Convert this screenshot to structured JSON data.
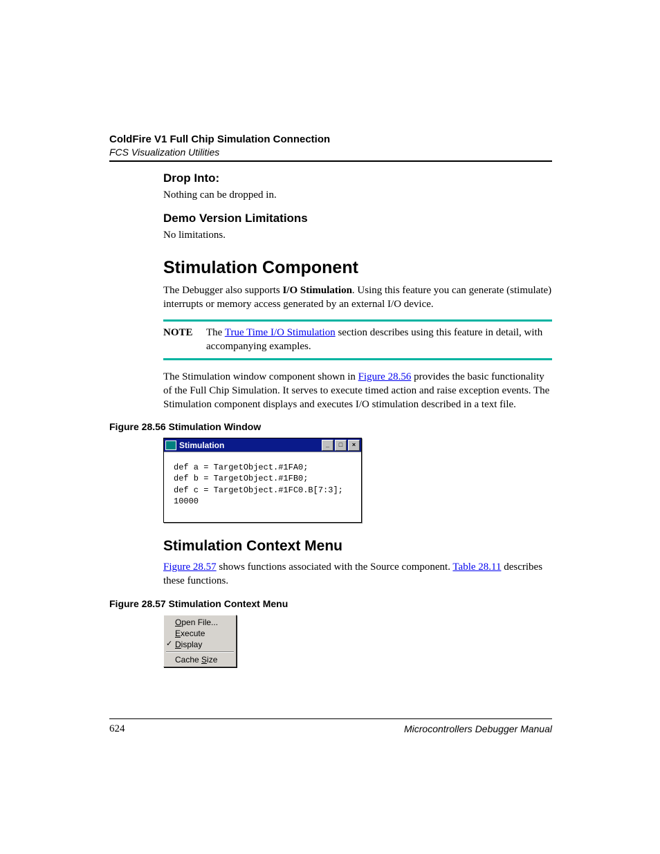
{
  "header": {
    "title": "ColdFire V1 Full Chip Simulation Connection",
    "subtitle": "FCS Visualization Utilities"
  },
  "sections": {
    "drop_into": {
      "heading": "Drop Into:",
      "body": "Nothing can be dropped in."
    },
    "demo_limits": {
      "heading": "Demo Version Limitations",
      "body": "No limitations."
    },
    "stim_comp": {
      "heading": "Stimulation Component",
      "p1_a": "The Debugger also supports ",
      "p1_bold": "I/O Stimulation",
      "p1_b": ". Using this feature you can generate (stimulate) interrupts or memory access generated by an external I/O device.",
      "note_label": "NOTE",
      "note_a": "The ",
      "note_link": "True Time I/O Stimulation",
      "note_b": " section describes using this feature in detail, with accompanying examples.",
      "p2_a": "The Stimulation window component shown in ",
      "p2_link": "Figure 28.56",
      "p2_b": " provides the basic functionality of the Full Chip Simulation. It serves to execute timed action and raise exception events. The Stimulation component displays and executes I/O stimulation described in a text file."
    },
    "fig56": {
      "caption": "Figure 28.56  Stimulation Window",
      "window_title": "Stimulation",
      "code": "def a = TargetObject.#1FA0;\ndef b = TargetObject.#1FB0;\ndef c = TargetObject.#1FC0.B[7:3];\n10000"
    },
    "ctx_menu": {
      "heading": "Stimulation Context Menu",
      "p_a1": "",
      "p_link1": "Figure 28.57",
      "p_a2": " shows functions associated with the Source component. ",
      "p_link2": "Table 28.11",
      "p_a3": " describes these functions."
    },
    "fig57": {
      "caption": "Figure 28.57  Stimulation Context Menu",
      "items": {
        "open": "Open File...",
        "execute": "Execute",
        "display": "Display",
        "cache": "Cache Size"
      }
    }
  },
  "footer": {
    "page": "624",
    "manual": "Microcontrollers Debugger Manual"
  }
}
